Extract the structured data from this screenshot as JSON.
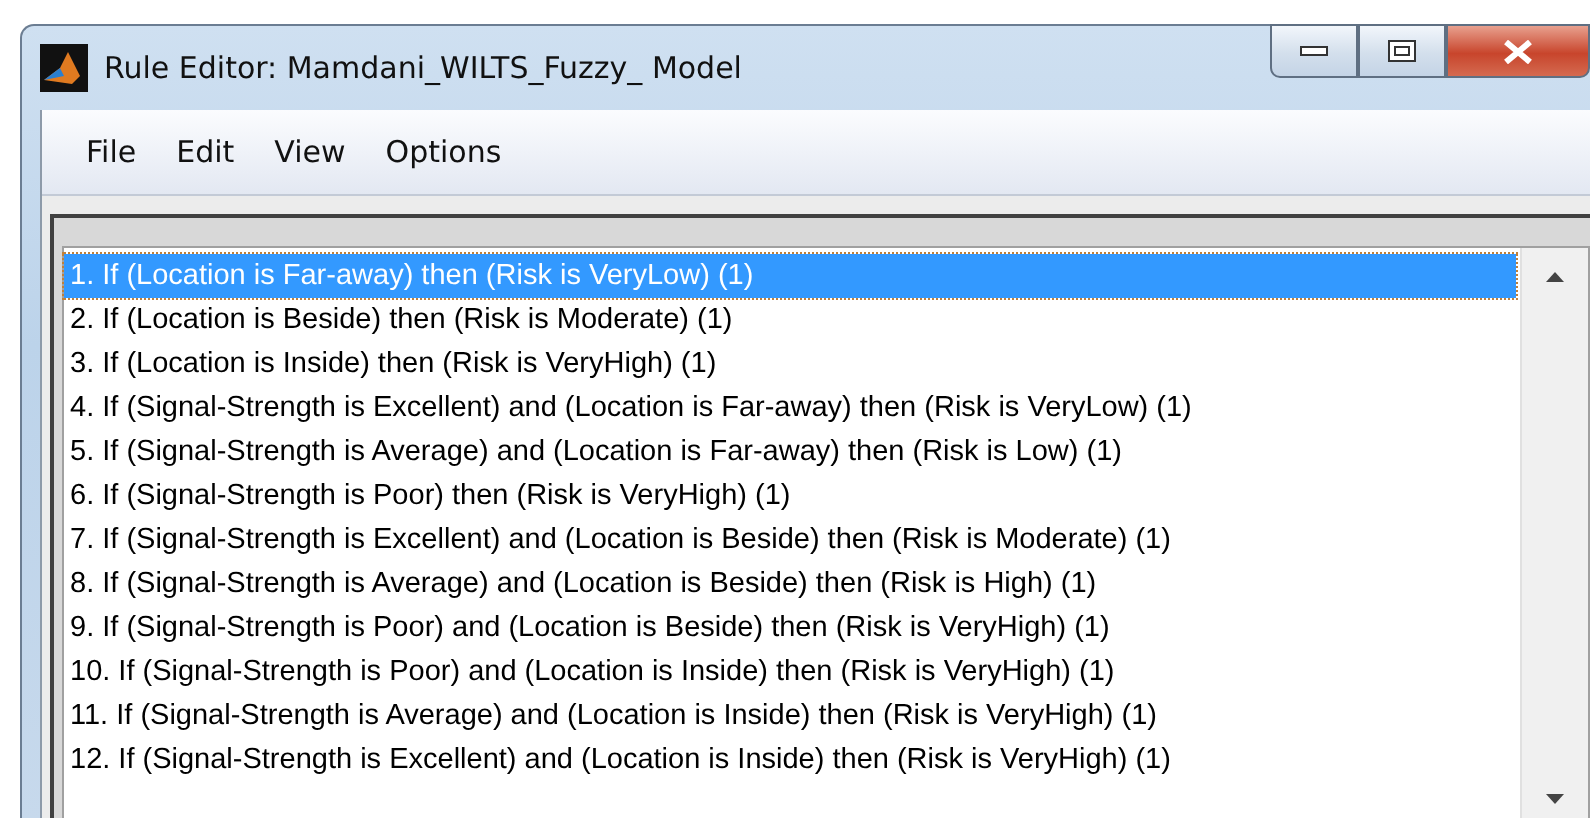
{
  "window": {
    "title": "Rule Editor: Mamdani_WILTS_Fuzzy_ Model"
  },
  "menu": [
    "File",
    "Edit",
    "View",
    "Options"
  ],
  "rules": [
    {
      "text": "1. If (Location is Far-away) then (Risk is VeryLow) (1)",
      "selected": true
    },
    {
      "text": "2. If (Location is Beside) then (Risk is Moderate) (1)",
      "selected": false
    },
    {
      "text": "3. If (Location is Inside) then (Risk is VeryHigh) (1)",
      "selected": false
    },
    {
      "text": "4. If (Signal-Strength is Excellent) and (Location is Far-away) then (Risk is VeryLow) (1)",
      "selected": false
    },
    {
      "text": "5. If (Signal-Strength is Average) and (Location is Far-away) then (Risk is Low) (1)",
      "selected": false
    },
    {
      "text": "6. If (Signal-Strength is Poor) then (Risk is VeryHigh) (1)",
      "selected": false
    },
    {
      "text": "7. If (Signal-Strength is Excellent) and (Location is Beside) then (Risk is Moderate) (1)",
      "selected": false
    },
    {
      "text": "8. If (Signal-Strength is Average) and (Location is Beside) then (Risk is High) (1)",
      "selected": false
    },
    {
      "text": "9. If (Signal-Strength is Poor) and (Location is Beside) then (Risk is VeryHigh) (1)",
      "selected": false
    },
    {
      "text": "10. If (Signal-Strength is Poor) and (Location is Inside) then (Risk is VeryHigh) (1)",
      "selected": false
    },
    {
      "text": "11. If (Signal-Strength is Average) and (Location is Inside) then (Risk is VeryHigh) (1)",
      "selected": false
    },
    {
      "text": "12. If (Signal-Strength is Excellent) and (Location is Inside) then (Risk is VeryHigh) (1)",
      "selected": false
    }
  ]
}
